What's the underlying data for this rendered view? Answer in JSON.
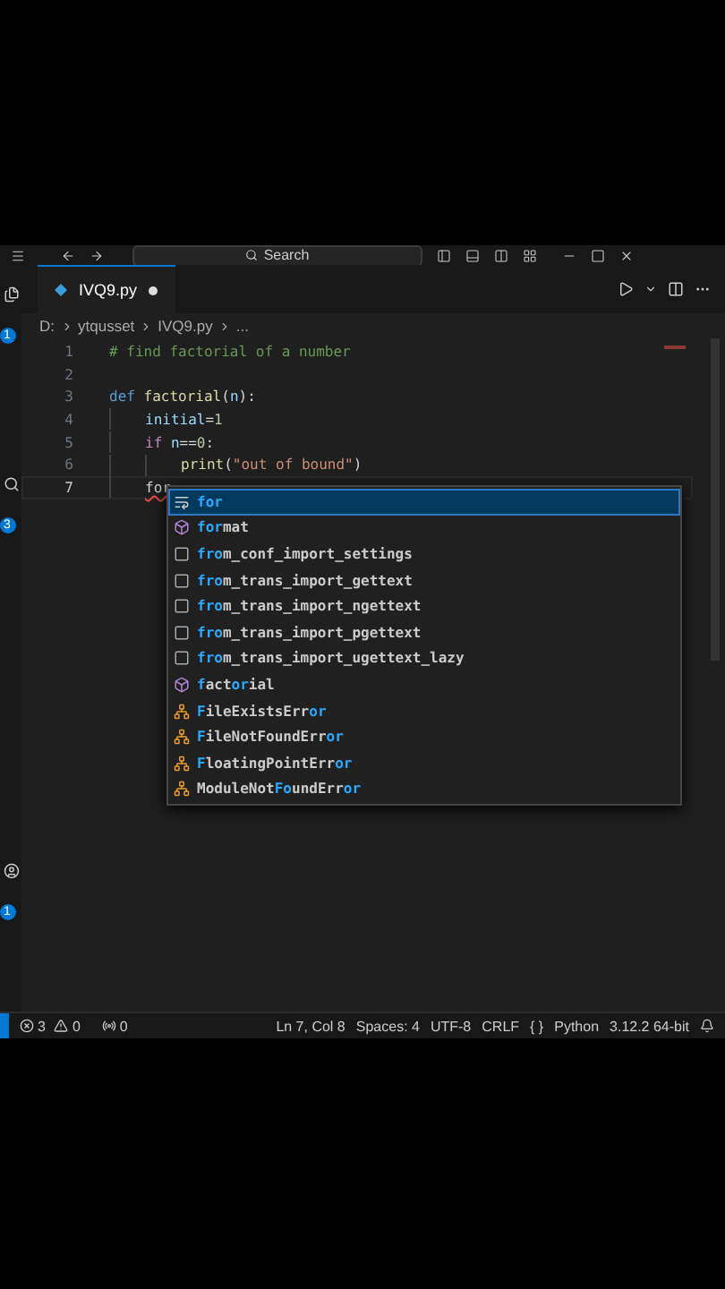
{
  "title_bar": {
    "search": {
      "placeholder": "Search"
    }
  },
  "tabs": [
    {
      "label": "IVQ9.py",
      "selected": true,
      "modified": true
    }
  ],
  "breadcrumb": [
    "D:",
    "ytqusset",
    "IVQ9.py",
    "..."
  ],
  "activity_badges": [
    "1",
    "3",
    "1"
  ],
  "code_lines": [
    {
      "number": "1",
      "current": false,
      "tokens": [
        {
          "kind": "comment",
          "text": "# find factorial of a number"
        }
      ]
    },
    {
      "number": "2",
      "current": false
    },
    {
      "number": "3",
      "current": false,
      "tokens": [
        {
          "kind": "keyword",
          "text": "def "
        },
        {
          "kind": "function",
          "text": "factorial"
        },
        {
          "kind": "plain",
          "text": "("
        },
        {
          "kind": "param",
          "text": "n"
        },
        {
          "kind": "plain",
          "text": "):"
        }
      ],
      "children": [
        {
          "number": "4",
          "current": false,
          "tokens": [
            {
              "kind": "variable",
              "text": "initial"
            },
            {
              "kind": "plain",
              "text": "="
            },
            {
              "kind": "number",
              "text": "1"
            }
          ]
        },
        {
          "number": "5",
          "current": false,
          "tokens": [
            {
              "kind": "control",
              "text": "if "
            },
            {
              "kind": "param",
              "text": "n"
            },
            {
              "kind": "plain",
              "text": "=="
            },
            {
              "kind": "number",
              "text": "0"
            },
            {
              "kind": "plain",
              "text": ":"
            }
          ],
          "children": [
            {
              "number": "6",
              "current": false,
              "tokens": [
                {
                  "kind": "function",
                  "text": "print"
                },
                {
                  "kind": "plain",
                  "text": "("
                },
                {
                  "kind": "string",
                  "text": "\"out of bound\""
                },
                {
                  "kind": "plain",
                  "text": ")"
                }
              ]
            }
          ]
        },
        {
          "number": "7",
          "current": true,
          "tokens": [
            {
              "kind": "error",
              "text": "for"
            }
          ]
        }
      ]
    }
  ],
  "suggestions": [
    {
      "kind": "keyword",
      "selected": true,
      "parts": [
        {
          "text": "for",
          "match": true
        }
      ]
    },
    {
      "kind": "function",
      "selected": false,
      "parts": [
        {
          "text": "for",
          "match": true
        },
        {
          "text": "mat",
          "match": false
        }
      ]
    },
    {
      "kind": "variable",
      "selected": false,
      "parts": [
        {
          "text": "fro",
          "match": true
        },
        {
          "text": "m_conf_import_settings",
          "match": false
        }
      ]
    },
    {
      "kind": "variable",
      "selected": false,
      "parts": [
        {
          "text": "fro",
          "match": true
        },
        {
          "text": "m_trans_import_gettext",
          "match": false
        }
      ]
    },
    {
      "kind": "variable",
      "selected": false,
      "parts": [
        {
          "text": "fro",
          "match": true
        },
        {
          "text": "m_trans_import_ngettext",
          "match": false
        }
      ]
    },
    {
      "kind": "variable",
      "selected": false,
      "parts": [
        {
          "text": "fro",
          "match": true
        },
        {
          "text": "m_trans_import_pgettext",
          "match": false
        }
      ]
    },
    {
      "kind": "variable",
      "selected": false,
      "parts": [
        {
          "text": "fro",
          "match": true
        },
        {
          "text": "m_trans_import_ugettext_lazy",
          "match": false
        }
      ]
    },
    {
      "kind": "function",
      "selected": false,
      "parts": [
        {
          "text": "f",
          "match": true
        },
        {
          "text": "act",
          "match": false
        },
        {
          "text": "or",
          "match": true
        },
        {
          "text": "ial",
          "match": false
        }
      ]
    },
    {
      "kind": "class",
      "selected": false,
      "parts": [
        {
          "text": "F",
          "match": true
        },
        {
          "text": "ileExistsErr",
          "match": false
        },
        {
          "text": "or",
          "match": true
        }
      ]
    },
    {
      "kind": "class",
      "selected": false,
      "parts": [
        {
          "text": "F",
          "match": true
        },
        {
          "text": "ileNotFoundErr",
          "match": false
        },
        {
          "text": "or",
          "match": true
        }
      ]
    },
    {
      "kind": "class",
      "selected": false,
      "parts": [
        {
          "text": "F",
          "match": true
        },
        {
          "text": "loatingPointErr",
          "match": false
        },
        {
          "text": "or",
          "match": true
        }
      ]
    },
    {
      "kind": "class",
      "selected": false,
      "parts": [
        {
          "text": "ModuleNot",
          "match": false
        },
        {
          "text": "Fo",
          "match": true
        },
        {
          "text": "undErr",
          "match": false
        },
        {
          "text": "or",
          "match": true
        }
      ]
    }
  ],
  "status_bar": {
    "errors": "3",
    "warnings": "0",
    "ports": "0",
    "items": [
      "Ln 7, Col 8",
      "Spaces: 4",
      "UTF-8",
      "CRLF"
    ],
    "language_icon": "{ }",
    "language": "Python",
    "interpreter": "3.12.2 64-bit"
  }
}
